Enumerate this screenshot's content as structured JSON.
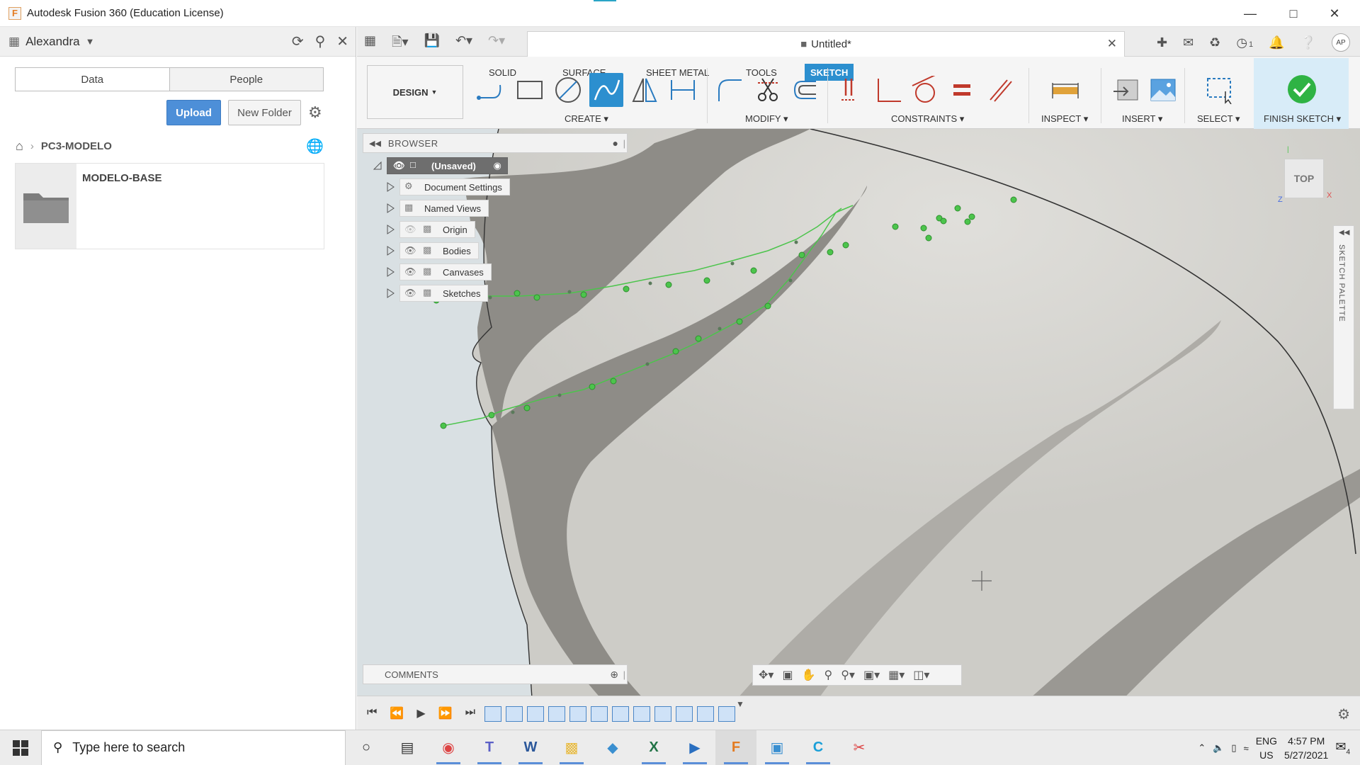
{
  "window": {
    "title": "Autodesk Fusion 360 (Education License)",
    "app_icon": "F",
    "controls": [
      "minimize-icon",
      "maximize-icon",
      "close-icon"
    ]
  },
  "data_panel": {
    "user": "Alexandra",
    "tabs": [
      {
        "label": "Data",
        "active": true
      },
      {
        "label": "People",
        "active": false
      }
    ],
    "upload_label": "Upload",
    "new_folder_label": "New Folder",
    "breadcrumb": "PC3-MODELO",
    "folders": [
      {
        "name": "MODELO-BASE"
      }
    ]
  },
  "document": {
    "tab_title": "Untitled*",
    "job_count": "1",
    "avatar": "AP"
  },
  "ribbon": {
    "workspace": "DESIGN",
    "tabs": [
      {
        "label": "SOLID",
        "active": false
      },
      {
        "label": "SURFACE",
        "active": false
      },
      {
        "label": "SHEET METAL",
        "active": false
      },
      {
        "label": "TOOLS",
        "active": false
      },
      {
        "label": "SKETCH",
        "active": true
      }
    ],
    "groups": {
      "create": "CREATE",
      "modify": "MODIFY",
      "constraints": "CONSTRAINTS",
      "inspect": "INSPECT",
      "insert": "INSERT",
      "select": "SELECT",
      "finish": "FINISH SKETCH"
    }
  },
  "browser": {
    "title": "BROWSER",
    "root": "(Unsaved)",
    "items": [
      {
        "label": "Document Settings"
      },
      {
        "label": "Named Views"
      },
      {
        "label": "Origin"
      },
      {
        "label": "Bodies"
      },
      {
        "label": "Canvases"
      },
      {
        "label": "Sketches"
      }
    ]
  },
  "viewcube": {
    "label": "TOP"
  },
  "sketch_palette": {
    "label": "SKETCH PALETTE"
  },
  "comments": {
    "label": "COMMENTS"
  },
  "taskbar": {
    "search_placeholder": "Type here to search",
    "language": "ENG",
    "region": "US",
    "time": "4:57 PM",
    "date": "5/27/2021",
    "notifications": "4"
  },
  "colors": {
    "accent": "#2c8fcf",
    "sketch_green": "#4cc44c",
    "finish_check": "#2fb344",
    "canvas_bg": "#d7d6d2",
    "sketch_band": "#8e8c87"
  }
}
